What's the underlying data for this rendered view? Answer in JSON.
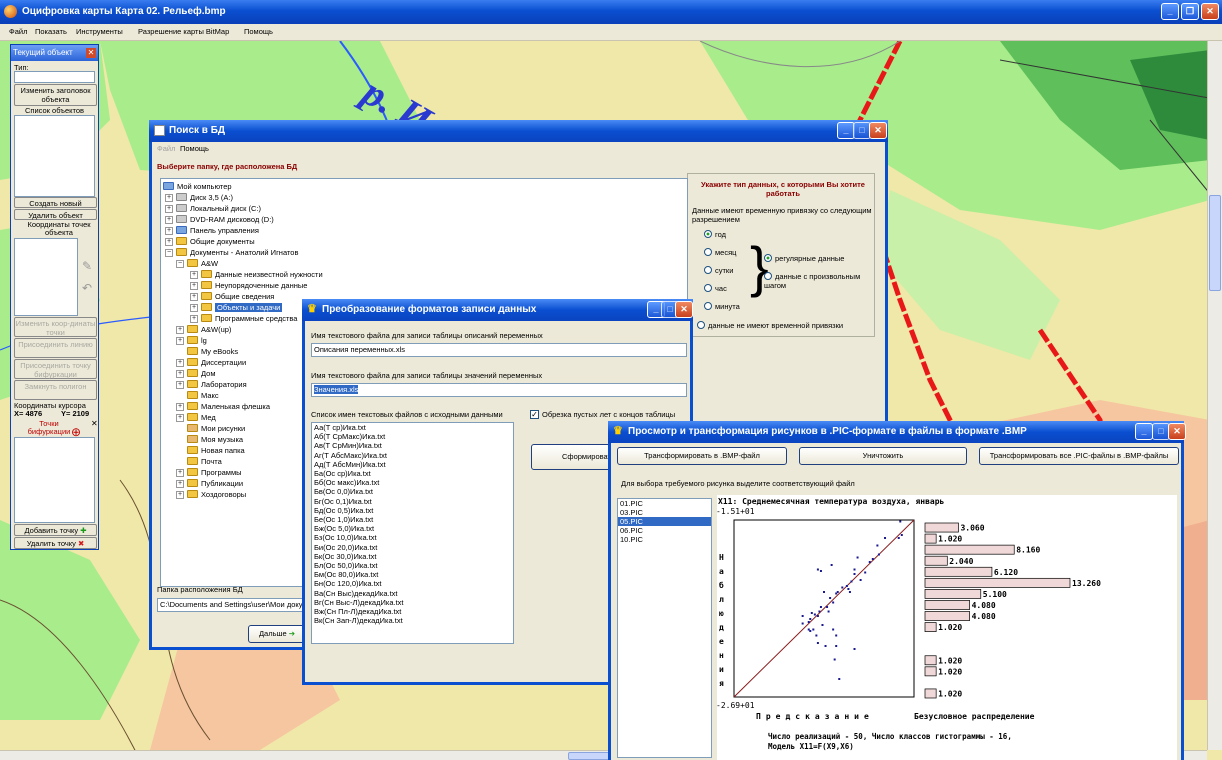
{
  "app": {
    "title": "Оцифровка карты Карта 02. Рельеф.bmp",
    "menu": [
      "Файл",
      "Показать",
      "Инструменты",
      "Разрешение карты BitMap",
      "Помощь"
    ],
    "map_label": "р. Ил"
  },
  "panel": {
    "title": "Текущий объект",
    "type_label": "Тип:",
    "change_header_btn": "Изменить заголовок объекта",
    "object_list_label": "Список объектов",
    "create_btn": "Создать новый",
    "delete_btn": "Удалить объект",
    "coords_label": "Координаты точек объекта",
    "change_coords_btn": "Изменить коор-динаты точки",
    "attach_line_btn": "Присоединить линию",
    "attach_bif_btn": "Присоединить точку бифуркации",
    "close_polygon_btn": "Замкнуть полигон",
    "cursor_coords_label": "Координаты курсора",
    "cursor_x": "X= 4876",
    "cursor_y": "Y= 2109",
    "bif_label": "Точки бифуркации",
    "add_point_btn": "Добавить точку",
    "del_point_btn": "Удалить точку"
  },
  "search": {
    "title": "Поиск в БД",
    "menu": [
      "Файл",
      "Помощь"
    ],
    "prompt": "Выберите папку, где расположена БД",
    "tree": [
      "Мой компьютер",
      "Диск 3,5 (A:)",
      "Локальный диск (C:)",
      "DVD-RAM дисковод (D:)",
      "Панель управления",
      "Общие документы",
      "Документы - Анатолий Игнатов",
      "A&W",
      "Данные неизвестной нужности",
      "Неупорядоченные данные",
      "Общие сведения",
      "Объекты и задачи",
      "Программные средства",
      "A&W(up)",
      "lg",
      "My eBooks",
      "Диссертации",
      "Дом",
      "Лаборатория",
      "Макс",
      "Маленькая флешка",
      "Мед",
      "Мои рисунки",
      "Моя музыка",
      "Новая папка",
      "Почта",
      "Программы",
      "Публикации",
      "Хоздоговоры"
    ],
    "data_type_title": "Укажите тип данных, с которыми Вы хотите работать",
    "data_type_desc": "Данные имеют временную привязку со следующим разрешением",
    "radios": [
      "год",
      "месяц",
      "сутки",
      "час",
      "минута"
    ],
    "radio_regular": "регулярные данные",
    "radio_arbitrary": "данные с произвольным шагом",
    "radio_no_time": "данные не имеют временной привязки",
    "folder_label": "Папка расположения БД",
    "folder_path": "C:\\Documents and Settings\\user\\Мои документы",
    "next_btn": "Дальше"
  },
  "convert": {
    "title": "Преобразование форматов записи данных",
    "desc_label": "Имя текстового файла для записи таблицы описаний переменных",
    "desc_value": "Описания переменных.xls",
    "values_label": "Имя текстового файла для записи таблицы значений переменных",
    "values_value": "Значения.xls",
    "list_label": "Список имен текстовых файлов с исходными данными",
    "trim_label": "Обрезка пустых лет с концов таблицы",
    "form_btn": "Сформировать",
    "files": [
      "Аа(Т ср)Ика.txt",
      "Аб(Т СрМакс)Ика.txt",
      "Ав(Т СрМин)Ика.txt",
      "Аг(Т АбсМакс)Ика.txt",
      "Ад(Т АбсМин)Ика.txt",
      "Ба(Ос ср)Ика.txt",
      "Бб(Ос макс)Ика.txt",
      "Бв(Ос 0,0)Ика.txt",
      "Бг(Ос 0,1)Ика.txt",
      "Бд(Ос 0,5)Ика.txt",
      "Бе(Ос 1,0)Ика.txt",
      "Бж(Ос 5,0)Ика.txt",
      "Бз(Ос 10,0)Ика.txt",
      "Би(Ос 20,0)Ика.txt",
      "Бк(Ос 30,0)Ика.txt",
      "Бл(Ос 50,0)Ика.txt",
      "Бм(Ос 80,0)Ика.txt",
      "Бн(Ос 120,0)Ика.txt",
      "Ва(Сн Выс)декадИка.txt",
      "Вг(Сн Выс-Л)декадИка.txt",
      "Вж(Сн Пл-Л)декадИка.txt",
      "Вк(Сн Зап-Л)декадИка.txt"
    ]
  },
  "viewer": {
    "title": "Просмотр и трансформация рисунков в .PIC-формате в файлы в формате .BMP",
    "btn_transform": "Трансформировать в .BMP-файл",
    "btn_delete": "Уничтожить",
    "btn_transform_all": "Трансформировать все .PIC-файлы в .BMP-файлы",
    "hint": "Для выбора требуемого рисунка выделите соответствующий файл",
    "files": [
      "01.PIC",
      "03.PIC",
      "05.PIC",
      "06.PIC",
      "10.PIC"
    ],
    "selected": 2
  },
  "chart_data": {
    "type": "scatter",
    "title": "X11: Среднемесячная температура воздуха, январь",
    "y_top_label": "-1.51+01",
    "y_bottom_label": "-2.69+01",
    "ylabel": "Наблюдения",
    "xlabel": "Предсказание",
    "hist_label": "Безусловное распределение",
    "footer1": "Число реализаций - 50,   Число классов гистограммы - 16,",
    "footer2": "Модель X11=F(X9,X6)",
    "lim": [
      -26.9,
      -15.1
    ],
    "points": [
      [
        -16,
        -15.2
      ],
      [
        -15.9,
        -16.1
      ],
      [
        -16.1,
        -16.3
      ],
      [
        -17,
        -16.3
      ],
      [
        -17.5,
        -16.8
      ],
      [
        -17.4,
        -17.4
      ],
      [
        -17.8,
        -17.7
      ],
      [
        -18,
        -17.9
      ],
      [
        -18.8,
        -17.6
      ],
      [
        -18.3,
        -18.6
      ],
      [
        -18.6,
        -19.1
      ],
      [
        -19,
        -18.7
      ],
      [
        -19.2,
        -19.2
      ],
      [
        -19.5,
        -19.5
      ],
      [
        -19.3,
        -19.9
      ],
      [
        -19.8,
        -19.6
      ],
      [
        -20.2,
        -20
      ],
      [
        -20.6,
        -20.3
      ],
      [
        -20.4,
        -20.6
      ],
      [
        -21,
        -19.9
      ],
      [
        -20.8,
        -20.9
      ],
      [
        -21.2,
        -20.9
      ],
      [
        -21.3,
        -21.2
      ],
      [
        -21.4,
        -21.5
      ],
      [
        -21.6,
        -21.4
      ],
      [
        -21.9,
        -21.7
      ],
      [
        -22,
        -22.4
      ],
      [
        -22.4,
        -22
      ],
      [
        -22.4,
        -21.5
      ],
      [
        -22,
        -21.9
      ],
      [
        -21.9,
        -22.5
      ],
      [
        -21.8,
        -21.3
      ],
      [
        -21.5,
        -22.8
      ],
      [
        -21.4,
        -23.3
      ],
      [
        -20.9,
        -23.5
      ],
      [
        -20.2,
        -23.5
      ],
      [
        -20.2,
        -22.8
      ],
      [
        -20.4,
        -22.4
      ],
      [
        -19,
        -23.7
      ],
      [
        -20,
        -25.7
      ],
      [
        -20.3,
        -24.4
      ],
      [
        -19,
        -18.4
      ],
      [
        -20.5,
        -18.1
      ],
      [
        -21.4,
        -18.4
      ],
      [
        -21.2,
        -18.5
      ],
      [
        -19.4,
        -19.7
      ],
      [
        -20.1,
        -19.9
      ],
      [
        -20.7,
        -21.2
      ],
      [
        -21.1,
        -22.1
      ],
      [
        -21.7,
        -22.4
      ]
    ],
    "histogram": [
      3.06,
      1.02,
      8.16,
      2.04,
      6.12,
      13.26,
      5.1,
      4.08,
      4.08,
      1.02,
      0,
      0,
      1.02,
      1.02,
      0,
      1.02
    ],
    "histogram_labels": [
      "3.060",
      "1.020",
      "8.160",
      "2.040",
      "6.120",
      "13.260",
      "5.100",
      "4.080",
      "4.080",
      "1.020",
      "",
      "",
      "1.020",
      "1.020",
      "",
      "1.020"
    ]
  }
}
